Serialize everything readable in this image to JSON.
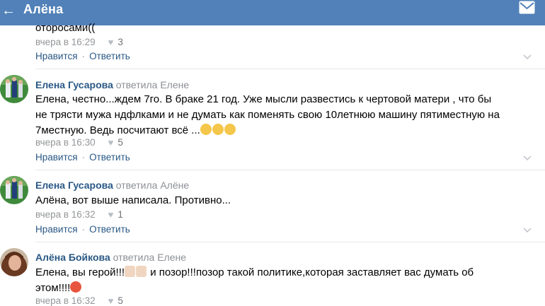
{
  "header": {
    "back_icon": "←",
    "title": "Алёна",
    "mail_icon": "mail-icon"
  },
  "colors": {
    "header_bg": "#5181b8",
    "author": "#2a5885",
    "meta": "#939699"
  },
  "comments": [
    {
      "text": "оторосами((",
      "time": "вчера в 16:29",
      "likes": "3",
      "like_label": "Нравится",
      "reply_label": "Ответить"
    },
    {
      "author": "Елена Гусарова",
      "replied": "ответила Елене",
      "text_lines": [
        "Елена, честно...ждем 7го. В браке 21 год. Уже мысли развестись к чертовой матери , что бы",
        "не трясти мужа ндфлками и не думать как поменять свою 10летнюю машину пятиместную на",
        "7местную. Ведь посчитают всё ..."
      ],
      "time": "вчера в 16:30",
      "likes": "5",
      "like_label": "Нравится",
      "reply_label": "Ответить"
    },
    {
      "author": "Елена Гусарова",
      "replied": "ответила Алёне",
      "text": "Алёна, вот выше написала. Противно...",
      "time": "вчера в 16:32",
      "likes": "1",
      "like_label": "Нравится",
      "reply_label": "Ответить"
    },
    {
      "author": "Алёна Бойкова",
      "replied": "ответила Елене",
      "text_lines": [
        "Елена, вы герой!!!",
        " и позор!!!позор такой политике,которая заставляет вас думать об",
        "этом!!!!"
      ],
      "time": "вчера в 16:32",
      "likes": "5"
    }
  ]
}
